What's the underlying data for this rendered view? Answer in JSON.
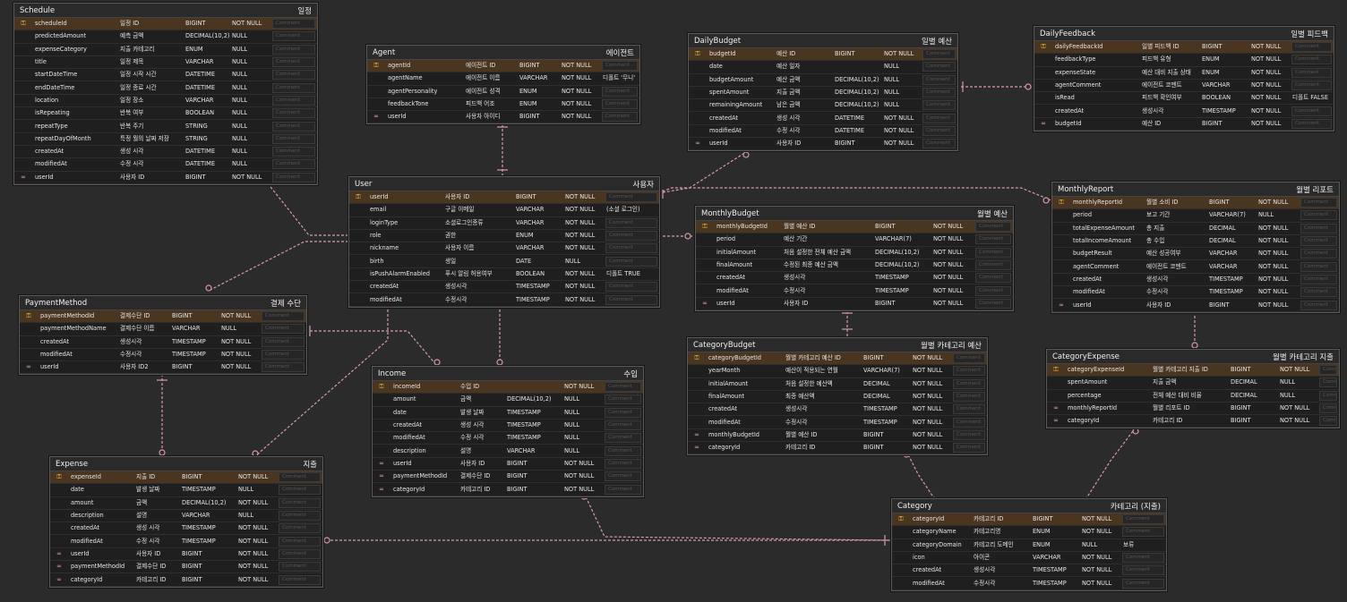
{
  "comment_placeholder": "Comment",
  "icons": {
    "primary_key": "key-icon",
    "foreign_key": "link-icon"
  },
  "colors": {
    "background": "#2b2b2b",
    "primary_key_row": "#4a3520",
    "relationship": "#d79aa9"
  },
  "entities": [
    {
      "id": "schedule",
      "name": "Schedule",
      "comment": "일정",
      "fields": [
        {
          "k": "pk",
          "name": "scheduleId",
          "label": "일정 ID",
          "type": "BIGINT",
          "null": "NOT NULL"
        },
        {
          "k": "",
          "name": "predictedAmount",
          "label": "예측 금액",
          "type": "DECIMAL(10,2)",
          "null": "NULL"
        },
        {
          "k": "",
          "name": "expenseCategory",
          "label": "지출 카테고리",
          "type": "ENUM",
          "null": "NULL"
        },
        {
          "k": "",
          "name": "title",
          "label": "일정 제목",
          "type": "VARCHAR",
          "null": "NULL"
        },
        {
          "k": "",
          "name": "startDateTime",
          "label": "일정 시작 시간",
          "type": "DATETIME",
          "null": "NULL"
        },
        {
          "k": "",
          "name": "endDateTime",
          "label": "일정 종료 시간",
          "type": "DATETIME",
          "null": "NULL"
        },
        {
          "k": "",
          "name": "location",
          "label": "일정 장소",
          "type": "VARCHAR",
          "null": "NULL"
        },
        {
          "k": "",
          "name": "isRepeating",
          "label": "반복 여부",
          "type": "BOOLEAN",
          "null": "NULL"
        },
        {
          "k": "",
          "name": "repeatType",
          "label": "반복 주기",
          "type": "STRING",
          "null": "NULL"
        },
        {
          "k": "",
          "name": "repeatDayOfMonth",
          "label": "특정 월의 날짜 저장",
          "type": "STRING",
          "null": "NULL"
        },
        {
          "k": "",
          "name": "createdAt",
          "label": "생성 시각",
          "type": "DATETIME",
          "null": "NULL"
        },
        {
          "k": "",
          "name": "modifiedAt",
          "label": "수정 시각",
          "type": "DATETIME",
          "null": "NULL"
        },
        {
          "k": "fk",
          "name": "userId",
          "label": "사용자 ID",
          "type": "BIGINT",
          "null": "NOT NULL"
        }
      ]
    },
    {
      "id": "agent",
      "name": "Agent",
      "comment": "에이전트",
      "fields": [
        {
          "k": "pk",
          "name": "agentId",
          "label": "에이전트 ID",
          "type": "BIGINT",
          "null": "NOT NULL"
        },
        {
          "k": "",
          "name": "agentName",
          "label": "에이전트 이름",
          "type": "VARCHAR",
          "null": "NOT NULL",
          "default": "디폴트 '무니'"
        },
        {
          "k": "",
          "name": "agentPersonality",
          "label": "에이전트 성격",
          "type": "ENUM",
          "null": "NOT NULL"
        },
        {
          "k": "",
          "name": "feedbackTone",
          "label": "피드백 어조",
          "type": "ENUM",
          "null": "NOT NULL"
        },
        {
          "k": "fk",
          "name": "userId",
          "label": "사용자 아이디",
          "type": "BIGINT",
          "null": "NOT NULL"
        }
      ]
    },
    {
      "id": "dailybudget",
      "name": "DailyBudget",
      "comment": "일별 예산",
      "fields": [
        {
          "k": "pk",
          "name": "budgetId",
          "label": "예산 ID",
          "type": "BIGINT",
          "null": "NOT NULL"
        },
        {
          "k": "",
          "name": "date",
          "label": "예산 일자",
          "type": "",
          "null": "NULL"
        },
        {
          "k": "",
          "name": "budgetAmount",
          "label": "예산 금액",
          "type": "DECIMAL(10,2)",
          "null": "NULL"
        },
        {
          "k": "",
          "name": "spentAmount",
          "label": "지출 금액",
          "type": "DECIMAL(10,2)",
          "null": "NULL"
        },
        {
          "k": "",
          "name": "remainingAmount",
          "label": "남은 금액",
          "type": "DECIMAL(10,2)",
          "null": "NULL"
        },
        {
          "k": "",
          "name": "createdAt",
          "label": "생성 시각",
          "type": "DATETIME",
          "null": "NOT NULL"
        },
        {
          "k": "",
          "name": "modifiedAt",
          "label": "수정 시각",
          "type": "DATETIME",
          "null": "NOT NULL"
        },
        {
          "k": "fk",
          "name": "userId",
          "label": "사용자 ID",
          "type": "BIGINT",
          "null": "NOT NULL"
        }
      ]
    },
    {
      "id": "dailyfeedback",
      "name": "DailyFeedback",
      "comment": "일별 피드백",
      "fields": [
        {
          "k": "pk",
          "name": "dailyFeedbackId",
          "label": "일별 피드백 ID",
          "type": "BIGINT",
          "null": "NOT NULL"
        },
        {
          "k": "",
          "name": "feedbackType",
          "label": "피드백 유형",
          "type": "ENUM",
          "null": "NOT NULL"
        },
        {
          "k": "",
          "name": "expenseState",
          "label": "예산 대비 지출 상태",
          "type": "ENUM",
          "null": "NOT NULL"
        },
        {
          "k": "",
          "name": "agentComment",
          "label": "에이전트 코멘트",
          "type": "VARCHAR",
          "null": "NOT NULL"
        },
        {
          "k": "",
          "name": "isRead",
          "label": "피드백 확인여부",
          "type": "BOOLEAN",
          "null": "NOT NULL",
          "default": "디폴트 FALSE"
        },
        {
          "k": "",
          "name": "createdAt",
          "label": "생성시각",
          "type": "TIMESTAMP",
          "null": "NOT NULL"
        },
        {
          "k": "fk",
          "name": "budgetId",
          "label": "예산 ID",
          "type": "BIGINT",
          "null": "NOT NULL"
        }
      ]
    },
    {
      "id": "user",
      "name": "User",
      "comment": "사용자",
      "fields": [
        {
          "k": "pk",
          "name": "userId",
          "label": "사용자 ID",
          "type": "BIGINT",
          "null": "NOT NULL"
        },
        {
          "k": "",
          "name": "email",
          "label": "구글 이메일",
          "type": "VARCHAR",
          "null": "NOT NULL",
          "default": "(소셜 로그인)"
        },
        {
          "k": "",
          "name": "loginType",
          "label": "소셜로그인종류",
          "type": "VARCHAR",
          "null": "NOT NULL"
        },
        {
          "k": "",
          "name": "role",
          "label": "권한",
          "type": "ENUM",
          "null": "NOT NULL"
        },
        {
          "k": "",
          "name": "nickname",
          "label": "사용자 이름",
          "type": "VARCHAR",
          "null": "NOT NULL"
        },
        {
          "k": "",
          "name": "birth",
          "label": "생일",
          "type": "DATE",
          "null": "NULL"
        },
        {
          "k": "",
          "name": "isPushAlarmEnabled",
          "label": "푸시 알림 허용여부",
          "type": "BOOLEAN",
          "null": "NOT NULL",
          "default": "디폴트 TRUE"
        },
        {
          "k": "",
          "name": "createdAt",
          "label": "생성시각",
          "type": "TIMESTAMP",
          "null": "NOT NULL"
        },
        {
          "k": "",
          "name": "modifiedAt",
          "label": "수정시각",
          "type": "TIMESTAMP",
          "null": "NOT NULL"
        }
      ]
    },
    {
      "id": "monthlybudget",
      "name": "MonthlyBudget",
      "comment": "월별 예산",
      "fields": [
        {
          "k": "pk",
          "name": "monthlyBudgetId",
          "label": "월별 예산 ID",
          "type": "BIGINT",
          "null": "NOT NULL"
        },
        {
          "k": "",
          "name": "period",
          "label": "예산 기간",
          "type": "VARCHAR(7)",
          "null": "NOT NULL"
        },
        {
          "k": "",
          "name": "initialAmount",
          "label": "처음 설정한 전체 예산 금액",
          "type": "DECIMAL(10,2)",
          "null": "NOT NULL"
        },
        {
          "k": "",
          "name": "finalAmount",
          "label": "수정된 최종 예산 금액",
          "type": "DECIMAL(10,2)",
          "null": "NOT NULL"
        },
        {
          "k": "",
          "name": "createdAt",
          "label": "생성시각",
          "type": "TIMESTAMP",
          "null": "NOT NULL"
        },
        {
          "k": "",
          "name": "modifiedAt",
          "label": "수정시각",
          "type": "TIMESTAMP",
          "null": "NOT NULL"
        },
        {
          "k": "fk",
          "name": "userId",
          "label": "사용자 ID",
          "type": "BIGINT",
          "null": "NOT NULL"
        }
      ]
    },
    {
      "id": "monthlyreport",
      "name": "MonthlyReport",
      "comment": "월별 리포트",
      "fields": [
        {
          "k": "pk",
          "name": "monthlyReportId",
          "label": "월별 소비 ID",
          "type": "BIGINT",
          "null": "NOT NULL"
        },
        {
          "k": "",
          "name": "period",
          "label": "보고 기간",
          "type": "VARCHAR(7)",
          "null": "NULL"
        },
        {
          "k": "",
          "name": "totalExpenseAmount",
          "label": "총 지출",
          "type": "DECIMAL",
          "null": "NOT NULL"
        },
        {
          "k": "",
          "name": "totalIncomeAmount",
          "label": "총 수입",
          "type": "DECIMAL",
          "null": "NOT NULL"
        },
        {
          "k": "",
          "name": "budgetResult",
          "label": "예산 성공여부",
          "type": "VARCHAR",
          "null": "NOT NULL"
        },
        {
          "k": "",
          "name": "agentComment",
          "label": "에이전트 코멘트",
          "type": "VARCHAR",
          "null": "NOT NULL"
        },
        {
          "k": "",
          "name": "createdAt",
          "label": "생성시각",
          "type": "TIMESTAMP",
          "null": "NOT NULL"
        },
        {
          "k": "",
          "name": "modifiedAt",
          "label": "수정시각",
          "type": "TIMESTAMP",
          "null": "NOT NULL"
        },
        {
          "k": "fk",
          "name": "userId",
          "label": "사용자 ID",
          "type": "BIGINT",
          "null": "NOT NULL"
        }
      ]
    },
    {
      "id": "paymentmethod",
      "name": "PaymentMethod",
      "comment": "결제 수단",
      "fields": [
        {
          "k": "pk",
          "name": "paymentMethodId",
          "label": "결제수단 ID",
          "type": "BIGINT",
          "null": "NOT NULL"
        },
        {
          "k": "",
          "name": "paymentMethodName",
          "label": "결제수단 이름",
          "type": "VARCHAR",
          "null": "NULL"
        },
        {
          "k": "",
          "name": "createdAt",
          "label": "생성시각",
          "type": "TIMESTAMP",
          "null": "NOT NULL"
        },
        {
          "k": "",
          "name": "modifiedAt",
          "label": "수정시각",
          "type": "TIMESTAMP",
          "null": "NOT NULL"
        },
        {
          "k": "fk",
          "name": "userId",
          "label": "사용자 ID2",
          "type": "BIGINT",
          "null": "NOT NULL"
        }
      ]
    },
    {
      "id": "income",
      "name": "Income",
      "comment": "수입",
      "fields": [
        {
          "k": "pk",
          "name": "incomeId",
          "label": "수입 ID",
          "type": "",
          "null": "NOT NULL"
        },
        {
          "k": "",
          "name": "amount",
          "label": "금액",
          "type": "DECIMAL(10,2)",
          "null": "NULL"
        },
        {
          "k": "",
          "name": "date",
          "label": "발생 날짜",
          "type": "TIMESTAMP",
          "null": "NULL"
        },
        {
          "k": "",
          "name": "createdAt",
          "label": "생성 시각",
          "type": "TIMESTAMP",
          "null": "NULL"
        },
        {
          "k": "",
          "name": "modifiedAt",
          "label": "수정 시각",
          "type": "TIMESTAMP",
          "null": "NULL"
        },
        {
          "k": "",
          "name": "description",
          "label": "설명",
          "type": "VARCHAR",
          "null": "NULL"
        },
        {
          "k": "fk",
          "name": "userId",
          "label": "사용자 ID",
          "type": "BIGINT",
          "null": "NOT NULL"
        },
        {
          "k": "fk",
          "name": "paymentMethodId",
          "label": "결제수단 ID",
          "type": "BIGINT",
          "null": "NOT NULL"
        },
        {
          "k": "fk",
          "name": "categoryId",
          "label": "카테고리 ID",
          "type": "BIGINT",
          "null": "NOT NULL"
        }
      ]
    },
    {
      "id": "categorybudget",
      "name": "CategoryBudget",
      "comment": "월별 카테고리 예산",
      "fields": [
        {
          "k": "pk",
          "name": "categoryBudgetId",
          "label": "월별 카테고리 예산 ID",
          "type": "BIGINT",
          "null": "NOT NULL"
        },
        {
          "k": "",
          "name": "yearMonth",
          "label": "예산이 적용되는 연월",
          "type": "VARCHAR(7)",
          "null": "NOT NULL"
        },
        {
          "k": "",
          "name": "initialAmount",
          "label": "처음 설정한 예산액",
          "type": "DECIMAL",
          "null": "NOT NULL"
        },
        {
          "k": "",
          "name": "finalAmount",
          "label": "최종 예산액",
          "type": "DECIMAL",
          "null": "NOT NULL"
        },
        {
          "k": "",
          "name": "createdAt",
          "label": "생성시각",
          "type": "TIMESTAMP",
          "null": "NOT NULL"
        },
        {
          "k": "",
          "name": "modifiedAt",
          "label": "수정시각",
          "type": "TIMESTAMP",
          "null": "NOT NULL"
        },
        {
          "k": "fk",
          "name": "monthlyBudgetId",
          "label": "월별 예산 ID",
          "type": "BIGINT",
          "null": "NOT NULL"
        },
        {
          "k": "fk",
          "name": "categoryId",
          "label": "카테고리 ID",
          "type": "BIGINT",
          "null": "NOT NULL"
        }
      ]
    },
    {
      "id": "categoryexpense",
      "name": "CategoryExpense",
      "comment": "월별 카테고리 지출",
      "fields": [
        {
          "k": "pk",
          "name": "categoryExpenseId",
          "label": "월별 카테고리 지출 ID",
          "type": "BIGINT",
          "null": "NOT NULL"
        },
        {
          "k": "",
          "name": "spentAmount",
          "label": "지출 금액",
          "type": "DECIMAL",
          "null": "NULL"
        },
        {
          "k": "",
          "name": "percentage",
          "label": "전체 예산 대비 비율",
          "type": "DECIMAL",
          "null": "NULL"
        },
        {
          "k": "fk",
          "name": "monthlyReportId",
          "label": "월별 리포트 ID",
          "type": "BIGINT",
          "null": "NOT NULL"
        },
        {
          "k": "fk",
          "name": "categoryId",
          "label": "카테고리 ID",
          "type": "BIGINT",
          "null": "NOT NULL"
        }
      ]
    },
    {
      "id": "expense",
      "name": "Expense",
      "comment": "지출",
      "fields": [
        {
          "k": "pk",
          "name": "expenseId",
          "label": "지출 ID",
          "type": "BIGINT",
          "null": "NOT NULL"
        },
        {
          "k": "",
          "name": "date",
          "label": "발생 날짜",
          "type": "TIMESTAMP",
          "null": "NULL"
        },
        {
          "k": "",
          "name": "amount",
          "label": "금액",
          "type": "DECIMAL(10,2)",
          "null": "NOT NULL"
        },
        {
          "k": "",
          "name": "description",
          "label": "설명",
          "type": "VARCHAR",
          "null": "NULL"
        },
        {
          "k": "",
          "name": "createdAt",
          "label": "생성 시각",
          "type": "TIMESTAMP",
          "null": "NOT NULL"
        },
        {
          "k": "",
          "name": "modifiedAt",
          "label": "수정 시각",
          "type": "TIMESTAMP",
          "null": "NOT NULL"
        },
        {
          "k": "fk",
          "name": "userId",
          "label": "사용자 ID",
          "type": "BIGINT",
          "null": "NOT NULL"
        },
        {
          "k": "fk",
          "name": "paymentMethodId",
          "label": "결제수단 ID",
          "type": "BIGINT",
          "null": "NOT NULL"
        },
        {
          "k": "fk",
          "name": "categoryId",
          "label": "카테고리 ID",
          "type": "BIGINT",
          "null": "NOT NULL"
        }
      ]
    },
    {
      "id": "category",
      "name": "Category",
      "comment": "카테고리 (지출)",
      "fields": [
        {
          "k": "pk",
          "name": "categoryId",
          "label": "카테고리 ID",
          "type": "BIGINT",
          "null": "NOT NULL"
        },
        {
          "k": "",
          "name": "categoryName",
          "label": "카테고리명",
          "type": "ENUM",
          "null": "NOT NULL"
        },
        {
          "k": "",
          "name": "categoryDomain",
          "label": "카테고리 도메인",
          "type": "ENUM",
          "null": "NULL",
          "default": "보류"
        },
        {
          "k": "",
          "name": "icon",
          "label": "아이콘",
          "type": "VARCHAR",
          "null": "NOT NULL"
        },
        {
          "k": "",
          "name": "createdAt",
          "label": "생성시각",
          "type": "TIMESTAMP",
          "null": "NOT NULL"
        },
        {
          "k": "",
          "name": "modifiedAt",
          "label": "수정시각",
          "type": "TIMESTAMP",
          "null": "NOT NULL"
        }
      ]
    }
  ]
}
